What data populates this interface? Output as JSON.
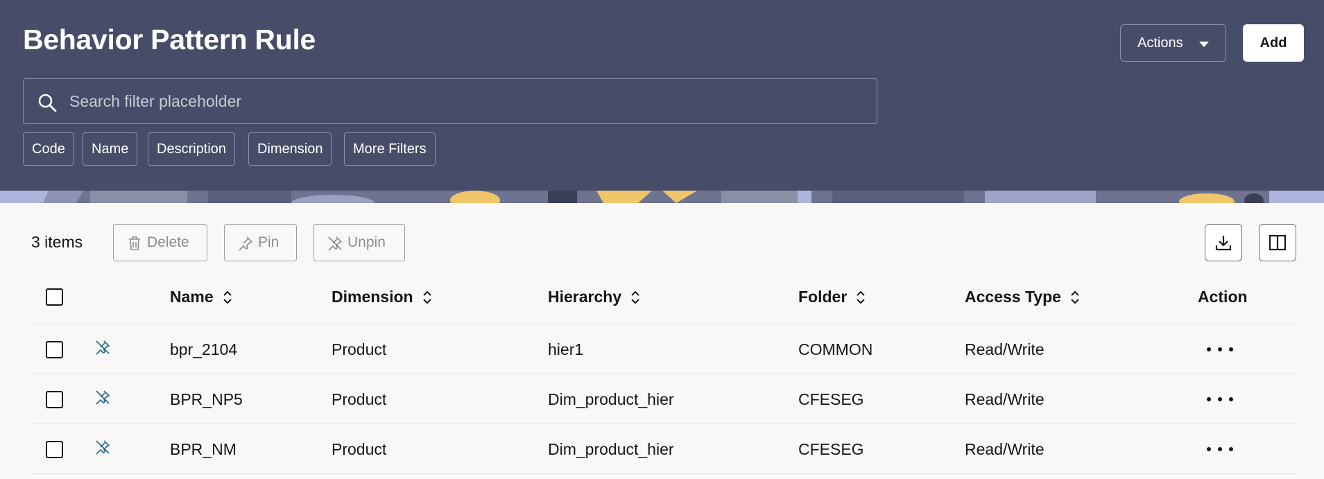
{
  "header": {
    "title": "Behavior Pattern Rule",
    "actions_label": "Actions",
    "add_label": "Add"
  },
  "search": {
    "placeholder": "Search filter placeholder",
    "value": ""
  },
  "filters": [
    "Code",
    "Name",
    "Description",
    "Dimension",
    "More Filters"
  ],
  "toolbar": {
    "count": "3 items",
    "delete_label": "Delete",
    "pin_label": "Pin",
    "unpin_label": "Unpin",
    "download_icon": "download-icon",
    "columns_icon": "columns-icon"
  },
  "table": {
    "columns": [
      "Name",
      "Dimension",
      "Hierarchy",
      "Folder",
      "Access Type",
      "Action"
    ],
    "rows": [
      {
        "name": "bpr_2104",
        "dimension": "Product",
        "hierarchy": "hier1",
        "folder": "COMMON",
        "access": "Read/Write"
      },
      {
        "name": "BPR_NP5",
        "dimension": "Product",
        "hierarchy": "Dim_product_hier",
        "folder": "CFESEG",
        "access": "Read/Write"
      },
      {
        "name": "BPR_NM",
        "dimension": "Product",
        "hierarchy": "Dim_product_hier",
        "folder": "CFESEG",
        "access": "Read/Write"
      }
    ]
  },
  "colors": {
    "header_bg": "#474c69",
    "page_bg": "#f9f8f6",
    "pin_icon": "#2a6f8f"
  }
}
